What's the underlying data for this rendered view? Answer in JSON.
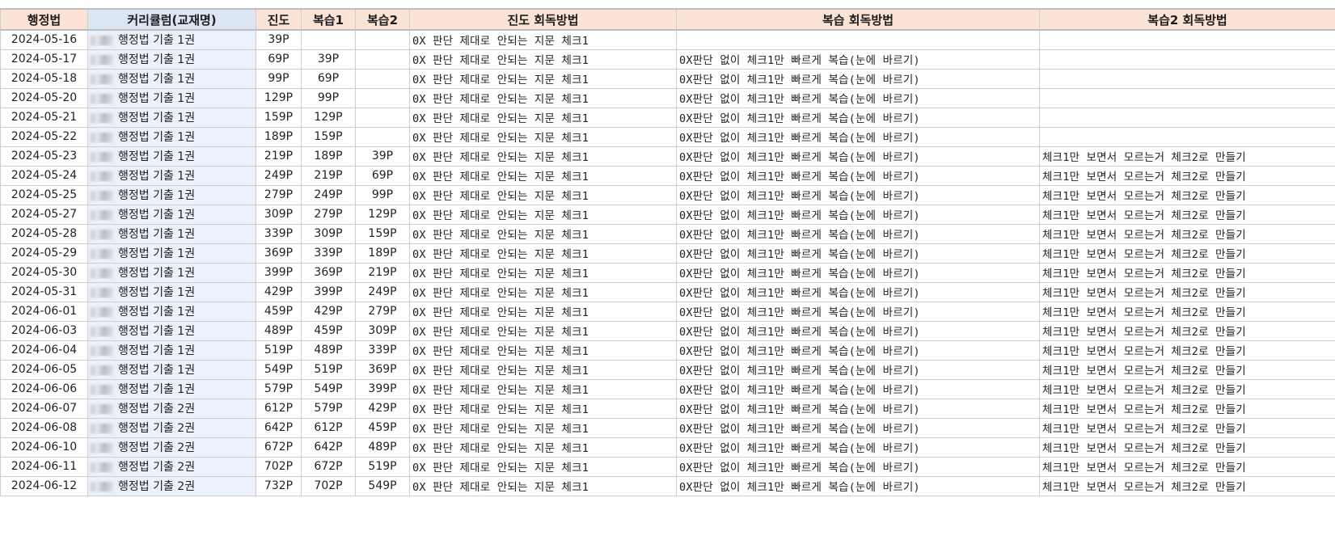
{
  "headers": {
    "subject": "행정법",
    "curriculum": "커리큘럼(교재명)",
    "progress": "진도",
    "review1": "복습1",
    "review2": "복습2",
    "progress_method": "진도 회독방법",
    "review_method": "복습 회독방법",
    "review2_method": "복습2 회독방법"
  },
  "rows": [
    {
      "date": "2024-05-16",
      "curr": "행정법 기출 1권",
      "prog": "39P",
      "r1": "",
      "r2": "",
      "m1": "0X 판단 제대로 안되는 지문 체크1",
      "m2": "",
      "m3": ""
    },
    {
      "date": "2024-05-17",
      "curr": "행정법 기출 1권",
      "prog": "69P",
      "r1": "39P",
      "r2": "",
      "m1": "0X 판단 제대로 안되는 지문 체크1",
      "m2": "0X판단 없이 체크1만 빠르게 복습(눈에 바르기)",
      "m3": ""
    },
    {
      "date": "2024-05-18",
      "curr": "행정법 기출 1권",
      "prog": "99P",
      "r1": "69P",
      "r2": "",
      "m1": "0X 판단 제대로 안되는 지문 체크1",
      "m2": "0X판단 없이 체크1만 빠르게 복습(눈에 바르기)",
      "m3": ""
    },
    {
      "date": "2024-05-20",
      "curr": "행정법 기출 1권",
      "prog": "129P",
      "r1": "99P",
      "r2": "",
      "m1": "0X 판단 제대로 안되는 지문 체크1",
      "m2": "0X판단 없이 체크1만 빠르게 복습(눈에 바르기)",
      "m3": ""
    },
    {
      "date": "2024-05-21",
      "curr": "행정법 기출 1권",
      "prog": "159P",
      "r1": "129P",
      "r2": "",
      "m1": "0X 판단 제대로 안되는 지문 체크1",
      "m2": "0X판단 없이 체크1만 빠르게 복습(눈에 바르기)",
      "m3": ""
    },
    {
      "date": "2024-05-22",
      "curr": "행정법 기출 1권",
      "prog": "189P",
      "r1": "159P",
      "r2": "",
      "m1": "0X 판단 제대로 안되는 지문 체크1",
      "m2": "0X판단 없이 체크1만 빠르게 복습(눈에 바르기)",
      "m3": ""
    },
    {
      "date": "2024-05-23",
      "curr": "행정법 기출 1권",
      "prog": "219P",
      "r1": "189P",
      "r2": "39P",
      "m1": "0X 판단 제대로 안되는 지문 체크1",
      "m2": "0X판단 없이 체크1만 빠르게 복습(눈에 바르기)",
      "m3": "체크1만 보면서 모르는거 체크2로 만들기"
    },
    {
      "date": "2024-05-24",
      "curr": "행정법 기출 1권",
      "prog": "249P",
      "r1": "219P",
      "r2": "69P",
      "m1": "0X 판단 제대로 안되는 지문 체크1",
      "m2": "0X판단 없이 체크1만 빠르게 복습(눈에 바르기)",
      "m3": "체크1만 보면서 모르는거 체크2로 만들기"
    },
    {
      "date": "2024-05-25",
      "curr": "행정법 기출 1권",
      "prog": "279P",
      "r1": "249P",
      "r2": "99P",
      "m1": "0X 판단 제대로 안되는 지문 체크1",
      "m2": "0X판단 없이 체크1만 빠르게 복습(눈에 바르기)",
      "m3": "체크1만 보면서 모르는거 체크2로 만들기"
    },
    {
      "date": "2024-05-27",
      "curr": "행정법 기출 1권",
      "prog": "309P",
      "r1": "279P",
      "r2": "129P",
      "m1": "0X 판단 제대로 안되는 지문 체크1",
      "m2": "0X판단 없이 체크1만 빠르게 복습(눈에 바르기)",
      "m3": "체크1만 보면서 모르는거 체크2로 만들기"
    },
    {
      "date": "2024-05-28",
      "curr": "행정법 기출 1권",
      "prog": "339P",
      "r1": "309P",
      "r2": "159P",
      "m1": "0X 판단 제대로 안되는 지문 체크1",
      "m2": "0X판단 없이 체크1만 빠르게 복습(눈에 바르기)",
      "m3": "체크1만 보면서 모르는거 체크2로 만들기"
    },
    {
      "date": "2024-05-29",
      "curr": "행정법 기출 1권",
      "prog": "369P",
      "r1": "339P",
      "r2": "189P",
      "m1": "0X 판단 제대로 안되는 지문 체크1",
      "m2": "0X판단 없이 체크1만 빠르게 복습(눈에 바르기)",
      "m3": "체크1만 보면서 모르는거 체크2로 만들기"
    },
    {
      "date": "2024-05-30",
      "curr": "행정법 기출 1권",
      "prog": "399P",
      "r1": "369P",
      "r2": "219P",
      "m1": "0X 판단 제대로 안되는 지문 체크1",
      "m2": "0X판단 없이 체크1만 빠르게 복습(눈에 바르기)",
      "m3": "체크1만 보면서 모르는거 체크2로 만들기"
    },
    {
      "date": "2024-05-31",
      "curr": "행정법 기출 1권",
      "prog": "429P",
      "r1": "399P",
      "r2": "249P",
      "m1": "0X 판단 제대로 안되는 지문 체크1",
      "m2": "0X판단 없이 체크1만 빠르게 복습(눈에 바르기)",
      "m3": "체크1만 보면서 모르는거 체크2로 만들기"
    },
    {
      "date": "2024-06-01",
      "curr": "행정법 기출 1권",
      "prog": "459P",
      "r1": "429P",
      "r2": "279P",
      "m1": "0X 판단 제대로 안되는 지문 체크1",
      "m2": "0X판단 없이 체크1만 빠르게 복습(눈에 바르기)",
      "m3": "체크1만 보면서 모르는거 체크2로 만들기"
    },
    {
      "date": "2024-06-03",
      "curr": "행정법 기출 1권",
      "prog": "489P",
      "r1": "459P",
      "r2": "309P",
      "m1": "0X 판단 제대로 안되는 지문 체크1",
      "m2": "0X판단 없이 체크1만 빠르게 복습(눈에 바르기)",
      "m3": "체크1만 보면서 모르는거 체크2로 만들기"
    },
    {
      "date": "2024-06-04",
      "curr": "행정법 기출 1권",
      "prog": "519P",
      "r1": "489P",
      "r2": "339P",
      "m1": "0X 판단 제대로 안되는 지문 체크1",
      "m2": "0X판단 없이 체크1만 빠르게 복습(눈에 바르기)",
      "m3": "체크1만 보면서 모르는거 체크2로 만들기"
    },
    {
      "date": "2024-06-05",
      "curr": "행정법 기출 1권",
      "prog": "549P",
      "r1": "519P",
      "r2": "369P",
      "m1": "0X 판단 제대로 안되는 지문 체크1",
      "m2": "0X판단 없이 체크1만 빠르게 복습(눈에 바르기)",
      "m3": "체크1만 보면서 모르는거 체크2로 만들기"
    },
    {
      "date": "2024-06-06",
      "curr": "행정법 기출 1권",
      "prog": "579P",
      "r1": "549P",
      "r2": "399P",
      "m1": "0X 판단 제대로 안되는 지문 체크1",
      "m2": "0X판단 없이 체크1만 빠르게 복습(눈에 바르기)",
      "m3": "체크1만 보면서 모르는거 체크2로 만들기"
    },
    {
      "date": "2024-06-07",
      "curr": "행정법 기출 2권",
      "prog": "612P",
      "r1": "579P",
      "r2": "429P",
      "m1": "0X 판단 제대로 안되는 지문 체크1",
      "m2": "0X판단 없이 체크1만 빠르게 복습(눈에 바르기)",
      "m3": "체크1만 보면서 모르는거 체크2로 만들기"
    },
    {
      "date": "2024-06-08",
      "curr": "행정법 기출 2권",
      "prog": "642P",
      "r1": "612P",
      "r2": "459P",
      "m1": "0X 판단 제대로 안되는 지문 체크1",
      "m2": "0X판단 없이 체크1만 빠르게 복습(눈에 바르기)",
      "m3": "체크1만 보면서 모르는거 체크2로 만들기"
    },
    {
      "date": "2024-06-10",
      "curr": "행정법 기출 2권",
      "prog": "672P",
      "r1": "642P",
      "r2": "489P",
      "m1": "0X 판단 제대로 안되는 지문 체크1",
      "m2": "0X판단 없이 체크1만 빠르게 복습(눈에 바르기)",
      "m3": "체크1만 보면서 모르는거 체크2로 만들기"
    },
    {
      "date": "2024-06-11",
      "curr": "행정법 기출 2권",
      "prog": "702P",
      "r1": "672P",
      "r2": "519P",
      "m1": "0X 판단 제대로 안되는 지문 체크1",
      "m2": "0X판단 없이 체크1만 빠르게 복습(눈에 바르기)",
      "m3": "체크1만 보면서 모르는거 체크2로 만들기"
    },
    {
      "date": "2024-06-12",
      "curr": "행정법 기출 2권",
      "prog": "732P",
      "r1": "702P",
      "r2": "549P",
      "m1": "0X 판단 제대로 안되는 지문 체크1",
      "m2": "0X판단 없이 체크1만 빠르게 복습(눈에 바르기)",
      "m3": "체크1만 보면서 모르는거 체크2로 만들기"
    }
  ]
}
